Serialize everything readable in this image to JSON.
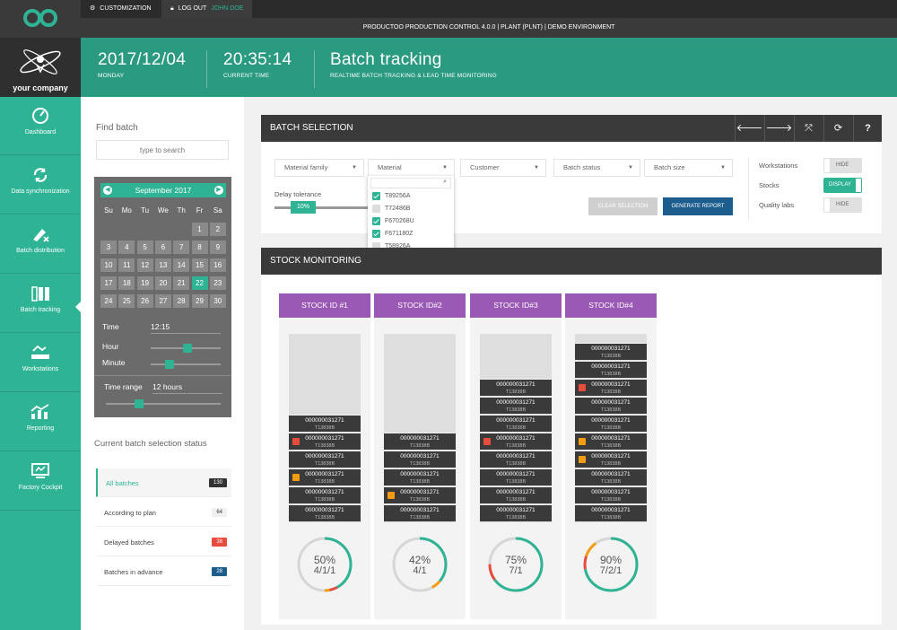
{
  "topbar": {
    "customization": "CUSTOMIZATION",
    "logout": "LOG OUT",
    "user": "JOHN DOE",
    "app_title": "PRODUCTOO PRODUCTION CONTROL 4.0.0 | PLANT (PLNT) | DEMO ENVIRONMENT"
  },
  "company": "your company",
  "header": {
    "date": "2017/12/04",
    "day": "MONDAY",
    "time": "20:35:14",
    "time_label": "CURRENT TIME",
    "title": "Batch tracking",
    "subtitle": "REALTIME BATCH TRACKING & LEAD TIME MONITORING"
  },
  "sidebar": {
    "items": [
      {
        "label": "Dashboard",
        "icon": "gauge-icon"
      },
      {
        "label": "Data synchronization",
        "icon": "sync-icon"
      },
      {
        "label": "Batch distribution",
        "icon": "distribution-icon"
      },
      {
        "label": "Batch tracking",
        "icon": "batch-tracking-icon"
      },
      {
        "label": "Workstations",
        "icon": "workstation-icon"
      },
      {
        "label": "Reporting",
        "icon": "reporting-icon"
      },
      {
        "label": "Factory Cockpit",
        "icon": "cockpit-icon"
      }
    ]
  },
  "find": {
    "label": "Find batch",
    "placeholder": "type to search"
  },
  "calendar": {
    "month": "September 2017",
    "dow": [
      "Su",
      "Mo",
      "Tu",
      "We",
      "Th",
      "Fr",
      "Sa"
    ],
    "days": [
      "1",
      "2",
      "3",
      "4",
      "5",
      "6",
      "7",
      "8",
      "9",
      "10",
      "11",
      "12",
      "13",
      "14",
      "15",
      "16",
      "17",
      "18",
      "19",
      "20",
      "21",
      "22",
      "23",
      "24",
      "25",
      "26",
      "27",
      "28",
      "29",
      "30"
    ],
    "selected": "22",
    "time_label": "Time",
    "time_value": "12:15",
    "hour_label": "Hour",
    "minute_label": "Minute",
    "hour_level": 0.52,
    "minute_level": 0.27,
    "range_label": "Time range",
    "range_value": "12 hours",
    "range_level": 0.29
  },
  "status": {
    "title": "Current batch selection status",
    "rows": [
      {
        "label": "All batches",
        "count": "130",
        "color": "#333333"
      },
      {
        "label": "According to plan",
        "count": "64",
        "color": "#f0f0f0"
      },
      {
        "label": "Delayed batches",
        "count": "38",
        "color": "#e74c3c"
      },
      {
        "label": "Batches in advance",
        "count": "28",
        "color": "#1c5d8e"
      }
    ]
  },
  "batch_selection": {
    "title": "BATCH SELECTION",
    "filters": [
      "Material family",
      "Material",
      "Customer",
      "Batch status",
      "Batch size"
    ],
    "delay_label": "Delay tolerance",
    "delay_value": "10%",
    "material_options": [
      {
        "label": "T89256A",
        "checked": true
      },
      {
        "label": "T72486B",
        "checked": false
      },
      {
        "label": "F670268U",
        "checked": true
      },
      {
        "label": "F671180Z",
        "checked": true
      },
      {
        "label": "T58926A",
        "checked": false
      }
    ],
    "clear": "CLEAR SELECTION",
    "report": "GENERATE REPORT",
    "toggles": [
      {
        "label": "Workstations",
        "state": "HIDE",
        "on": false
      },
      {
        "label": "Stocks",
        "state": "DISPLAY",
        "on": true
      },
      {
        "label": "Quality labs",
        "state": "HIDE",
        "on": false
      }
    ]
  },
  "stock_monitoring": {
    "title": "STOCK MONITORING",
    "stocks": [
      {
        "name": "STOCK ID #1",
        "pct": "50%",
        "fraction": "4/1/1",
        "pct_value": 50,
        "red": 5,
        "orange": 3,
        "cells": [
          {
            "id": "000000031271",
            "code": "T13838B",
            "icon": ""
          },
          {
            "id": "000000031271",
            "code": "T13838B",
            "icon": "lock"
          },
          {
            "id": "000000031271",
            "code": "T13838B",
            "icon": ""
          },
          {
            "id": "000000031271",
            "code": "T13838B",
            "icon": "warn"
          },
          {
            "id": "000000031271",
            "code": "T13838B",
            "icon": ""
          },
          {
            "id": "000000031271",
            "code": "T13838B",
            "icon": ""
          }
        ]
      },
      {
        "name": "STOCK ID#2",
        "pct": "42%",
        "fraction": "4/1",
        "pct_value": 42,
        "red": 0,
        "orange": 6,
        "cells": [
          {
            "id": "000000031271",
            "code": "T13838B",
            "icon": ""
          },
          {
            "id": "000000031271",
            "code": "T13838B",
            "icon": ""
          },
          {
            "id": "000000031271",
            "code": "T13838B",
            "icon": ""
          },
          {
            "id": "000000031271",
            "code": "T13838B",
            "icon": "warn"
          },
          {
            "id": "000000031271",
            "code": "T13838B",
            "icon": ""
          }
        ]
      },
      {
        "name": "STOCK ID#3",
        "pct": "75%",
        "fraction": "7/1",
        "pct_value": 75,
        "red": 10,
        "orange": 0,
        "cells": [
          {
            "id": "000000031271",
            "code": "T13838B",
            "icon": ""
          },
          {
            "id": "000000031271",
            "code": "T13838B",
            "icon": ""
          },
          {
            "id": "000000031271",
            "code": "T13838B",
            "icon": ""
          },
          {
            "id": "000000031271",
            "code": "T13838B",
            "icon": "lock"
          },
          {
            "id": "000000031271",
            "code": "T13838B",
            "icon": ""
          },
          {
            "id": "000000031271",
            "code": "T13838B",
            "icon": ""
          },
          {
            "id": "000000031271",
            "code": "T13838B",
            "icon": ""
          },
          {
            "id": "000000031271",
            "code": "T13838B",
            "icon": ""
          }
        ]
      },
      {
        "name": "STOCK ID#4",
        "pct": "90%",
        "fraction": "7/2/1",
        "pct_value": 90,
        "red": 8,
        "orange": 10,
        "cells": [
          {
            "id": "000000031271",
            "code": "T13838B",
            "icon": ""
          },
          {
            "id": "000000031271",
            "code": "T13838B",
            "icon": ""
          },
          {
            "id": "000000031271",
            "code": "T13838B",
            "icon": "lock"
          },
          {
            "id": "000000031271",
            "code": "T13838B",
            "icon": ""
          },
          {
            "id": "000000031271",
            "code": "T13838B",
            "icon": ""
          },
          {
            "id": "000000031271",
            "code": "T13838B",
            "icon": "warn"
          },
          {
            "id": "000000031271",
            "code": "T13838B",
            "icon": "warn"
          },
          {
            "id": "000000031271",
            "code": "T13838B",
            "icon": ""
          },
          {
            "id": "000000031271",
            "code": "T13838B",
            "icon": ""
          },
          {
            "id": "000000031271",
            "code": "T13838B",
            "icon": ""
          }
        ]
      }
    ]
  },
  "colors": {
    "accent": "#2eb394",
    "header": "#2a9a80",
    "purple": "#9b59b6",
    "blue": "#1c5d8e",
    "red": "#e74c3c",
    "orange": "#f39c12"
  }
}
